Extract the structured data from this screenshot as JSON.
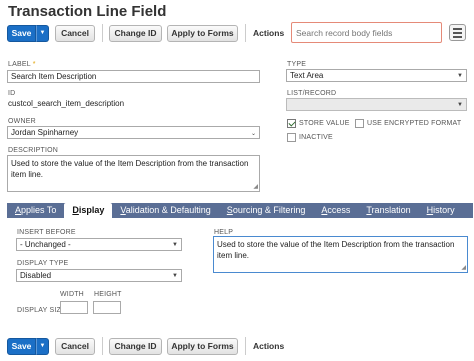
{
  "page": {
    "title": "Transaction Line Field"
  },
  "toolbar": {
    "save_label": "Save",
    "save_arrow": "▼",
    "cancel_label": "Cancel",
    "change_id_label": "Change ID",
    "apply_forms_label": "Apply to Forms",
    "actions_label": "Actions",
    "search_placeholder": "Search record body fields"
  },
  "form": {
    "label": {
      "caption": "LABEL",
      "required_mark": "*",
      "value": "Search Item Description"
    },
    "id": {
      "caption": "ID",
      "value": "custcol_search_item_description"
    },
    "owner": {
      "caption": "OWNER",
      "value": "Jordan Spinharney"
    },
    "description": {
      "caption": "DESCRIPTION",
      "value": "Used to store the value of the Item Description from the transaction item line."
    },
    "type": {
      "caption": "TYPE",
      "value": "Text Area"
    },
    "list_record": {
      "caption": "LIST/RECORD",
      "value": ""
    },
    "store_value": {
      "caption": "STORE VALUE",
      "checked": true
    },
    "use_encrypted": {
      "caption": "USE ENCRYPTED FORMAT",
      "checked": false
    },
    "inactive": {
      "caption": "INACTIVE",
      "checked": false
    }
  },
  "tabs": [
    {
      "label": "Applies To",
      "active": false
    },
    {
      "label": "Display",
      "active": true
    },
    {
      "label": "Validation & Defaulting",
      "active": false
    },
    {
      "label": "Sourcing & Filtering",
      "active": false
    },
    {
      "label": "Access",
      "active": false
    },
    {
      "label": "Translation",
      "active": false
    },
    {
      "label": "History",
      "active": false
    }
  ],
  "display": {
    "insert_before": {
      "caption": "INSERT BEFORE",
      "value": "- Unchanged -"
    },
    "display_type": {
      "caption": "DISPLAY TYPE",
      "value": "Disabled"
    },
    "display_size": {
      "caption": "DISPLAY SIZE",
      "width_caption": "WIDTH",
      "height_caption": "HEIGHT",
      "width_value": "",
      "height_value": ""
    },
    "help": {
      "caption": "HELP",
      "value": "Used to store the value of the Item Description from the transaction item line."
    }
  },
  "colors": {
    "accent": "#1b6fc6",
    "tabbar": "#5a6e95",
    "search_border": "#e58a78"
  }
}
